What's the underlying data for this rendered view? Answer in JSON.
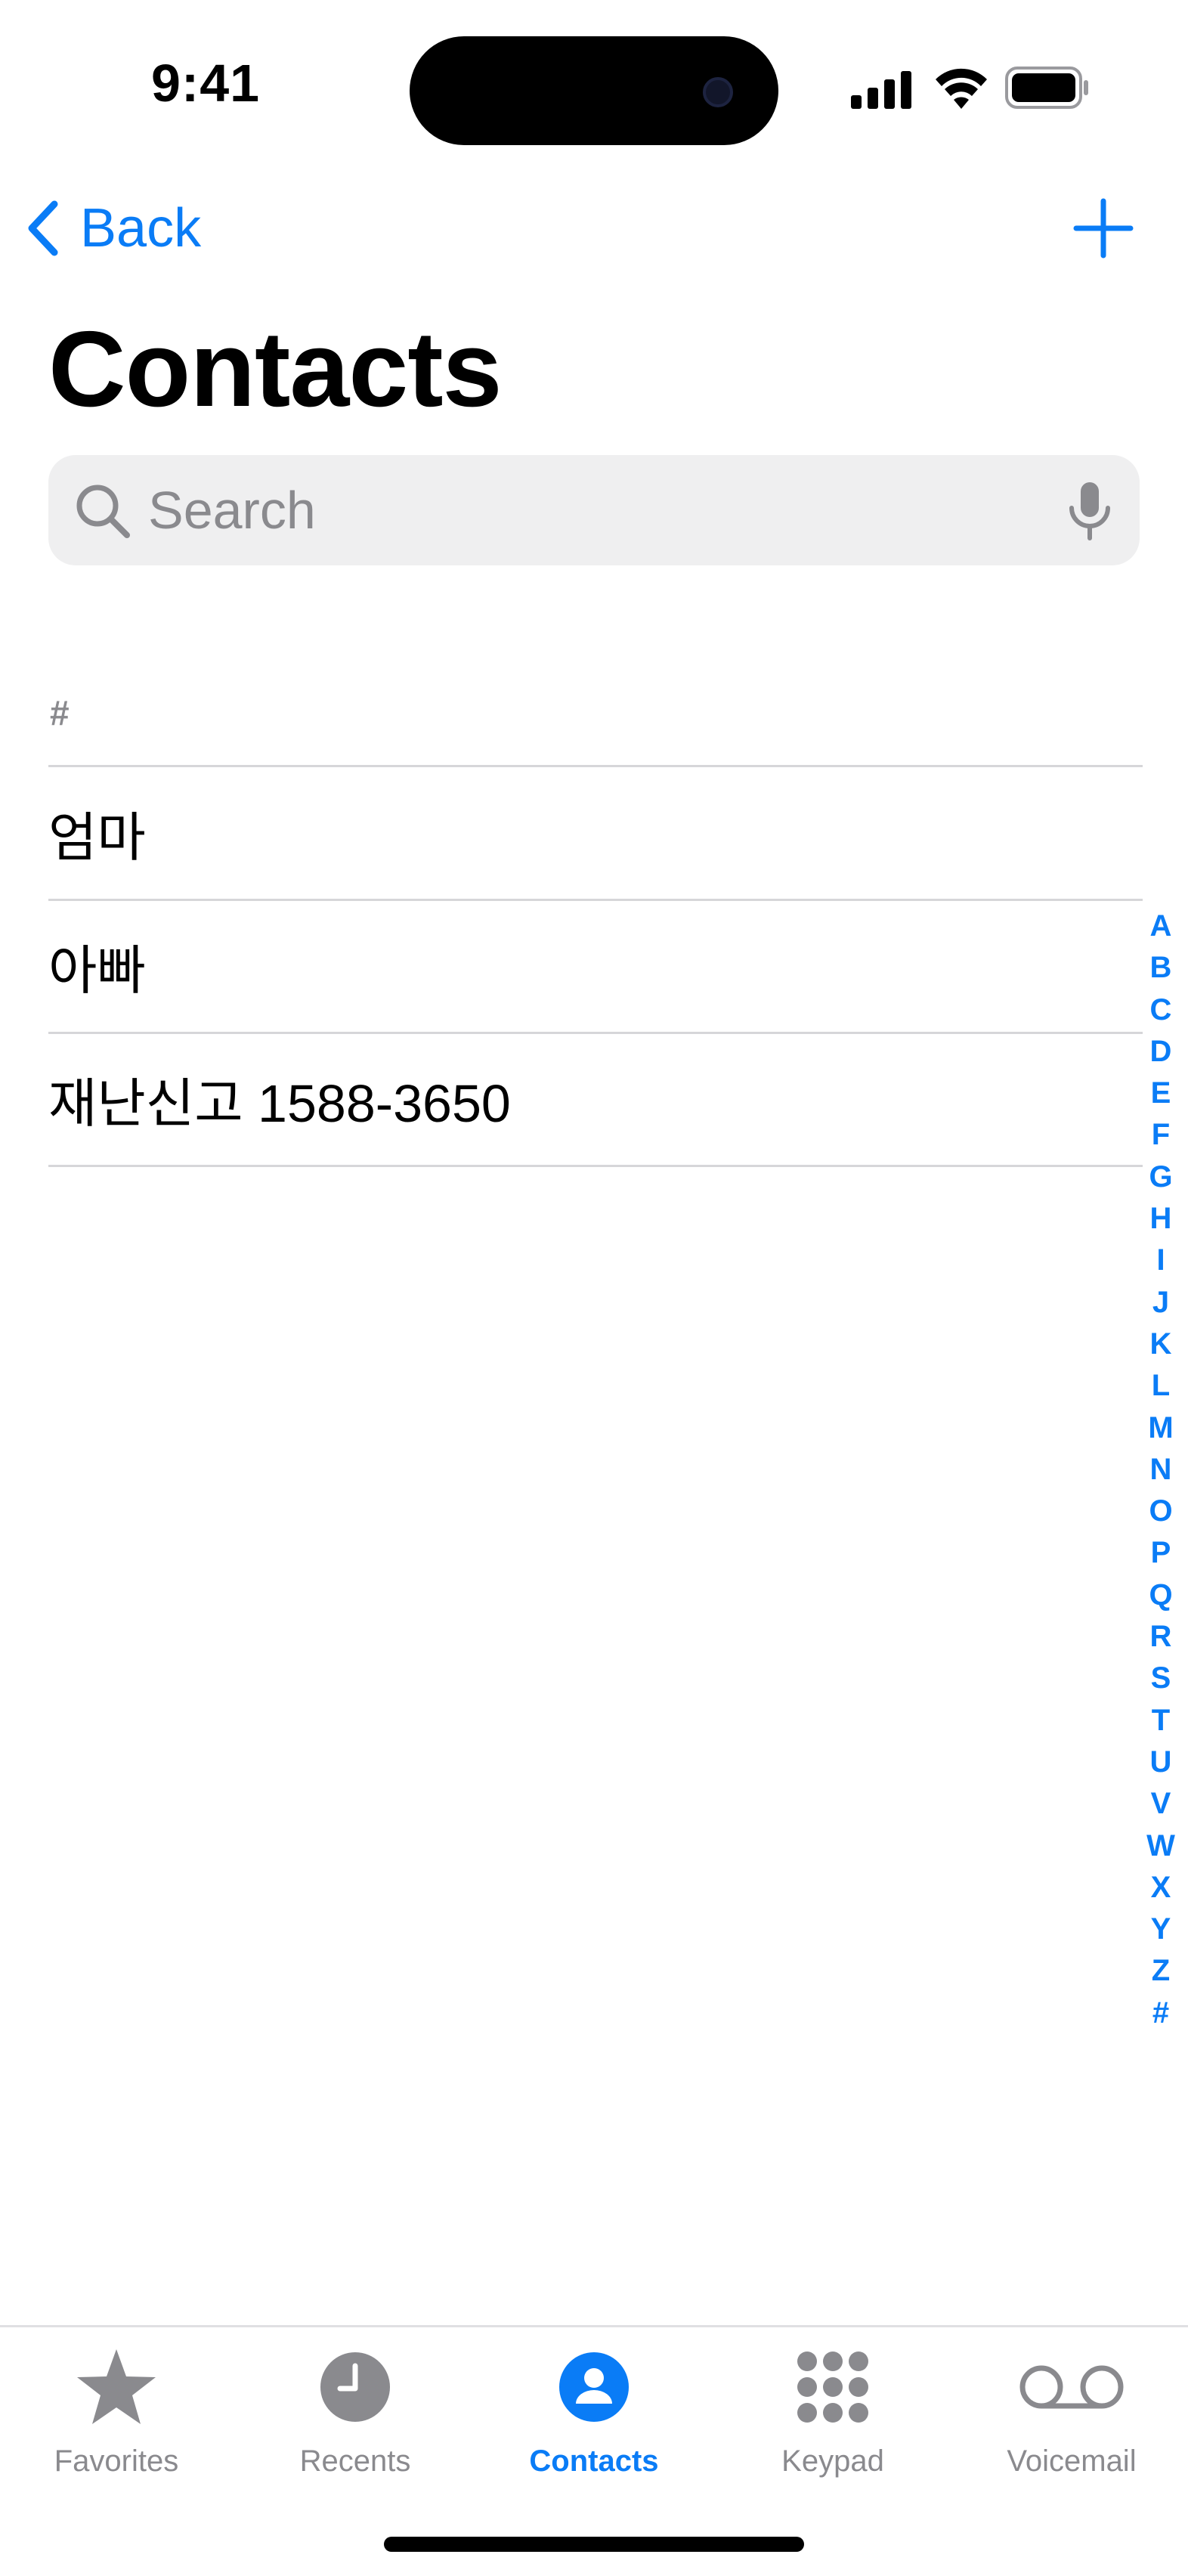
{
  "status_bar": {
    "time": "9:41"
  },
  "nav": {
    "back_label": "Back"
  },
  "page_title": "Contacts",
  "search": {
    "placeholder": "Search",
    "value": ""
  },
  "section": {
    "header": "#"
  },
  "contacts": [
    {
      "name": "엄마"
    },
    {
      "name": "아빠"
    },
    {
      "name": "재난신고 1588-3650"
    }
  ],
  "index_letters": [
    "A",
    "B",
    "C",
    "D",
    "E",
    "F",
    "G",
    "H",
    "I",
    "J",
    "K",
    "L",
    "M",
    "N",
    "O",
    "P",
    "Q",
    "R",
    "S",
    "T",
    "U",
    "V",
    "W",
    "X",
    "Y",
    "Z",
    "#"
  ],
  "tabs": [
    {
      "label": "Favorites",
      "icon": "star-icon",
      "active": false
    },
    {
      "label": "Recents",
      "icon": "clock-icon",
      "active": false
    },
    {
      "label": "Contacts",
      "icon": "person-icon",
      "active": true
    },
    {
      "label": "Keypad",
      "icon": "keypad-icon",
      "active": false
    },
    {
      "label": "Voicemail",
      "icon": "voicemail-icon",
      "active": false
    }
  ],
  "colors": {
    "accent": "#0a7cf6",
    "inactive": "#8a8a8e",
    "search_bg": "#efeff0"
  }
}
